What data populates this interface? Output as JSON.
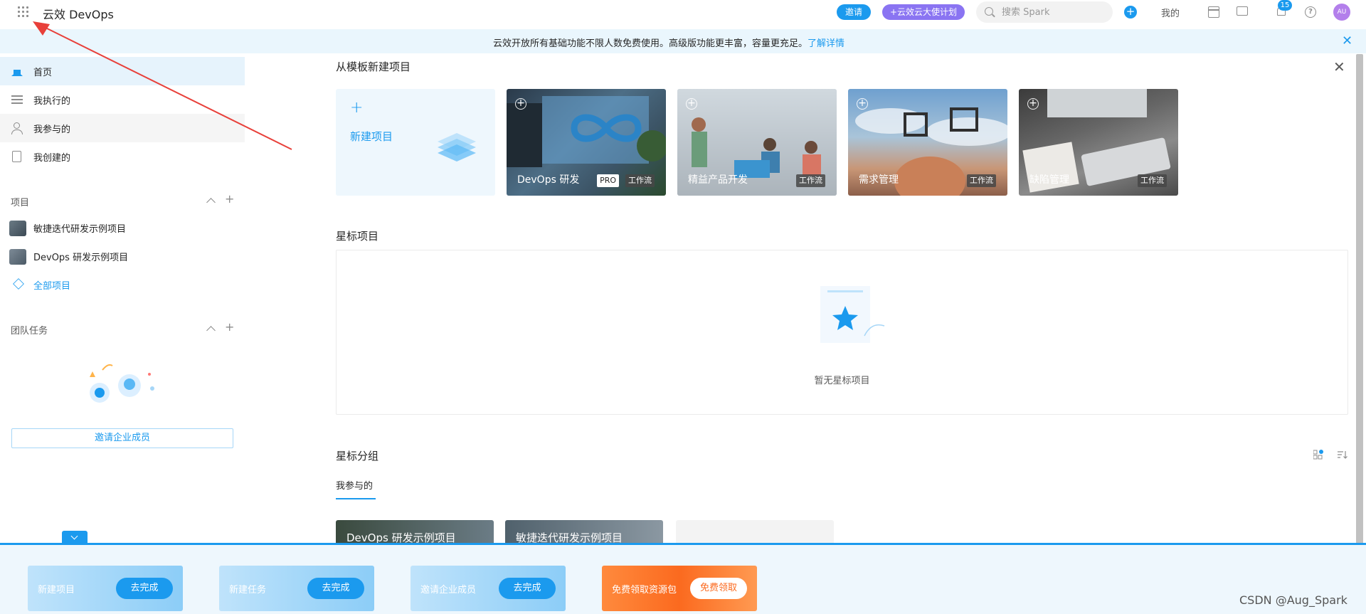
{
  "header": {
    "brand": "云效 DevOps",
    "invite_label": "邀请",
    "ambassador_label": "+云效云大使计划",
    "search_placeholder": "搜索 Spark",
    "mine_label": "我的",
    "notification_count": "15",
    "avatar_initials": "AU"
  },
  "notice": {
    "text": "云效开放所有基础功能不限人数免费使用。高级版功能更丰富，容量更充足。",
    "link": "了解详情"
  },
  "sidebar": {
    "nav": [
      {
        "label": "首页"
      },
      {
        "label": "我执行的"
      },
      {
        "label": "我参与的"
      },
      {
        "label": "我创建的"
      }
    ],
    "projects_title": "项目",
    "projects": [
      {
        "label": "敏捷迭代研发示例项目"
      },
      {
        "label": "DevOps 研发示例项目"
      }
    ],
    "all_projects": "全部项目",
    "team_title": "团队任务",
    "invite_members": "邀请企业成员"
  },
  "main": {
    "template_title": "从模板新建项目",
    "new_project": "新建项目",
    "templates": [
      {
        "name": "DevOps 研发",
        "badge": "PRO",
        "tag": "工作流"
      },
      {
        "name": "精益产品开发",
        "tag": "工作流"
      },
      {
        "name": "需求管理",
        "tag": "工作流"
      },
      {
        "name": "缺陷管理",
        "tag": "工作流"
      }
    ],
    "starred_title": "星标项目",
    "starred_empty": "暂无星标项目",
    "star_group_title": "星标分组",
    "tab_participated": "我参与的",
    "group_cards": [
      {
        "name": "DevOps 研发示例项目"
      },
      {
        "name": "敏捷迭代研发示例项目"
      }
    ]
  },
  "tasks": [
    {
      "label": "新建项目",
      "action": "去完成"
    },
    {
      "label": "新建任务",
      "action": "去完成"
    },
    {
      "label": "邀请企业成员",
      "action": "去完成"
    },
    {
      "label": "免费领取资源包",
      "action": "免费领取"
    }
  ],
  "watermark": "CSDN @Aug_Spark",
  "colors": {
    "accent": "#1b9aee",
    "ambassador": "#8a74f2",
    "promo": "#fb6a1f",
    "annotation_arrow": "#e8403a"
  }
}
